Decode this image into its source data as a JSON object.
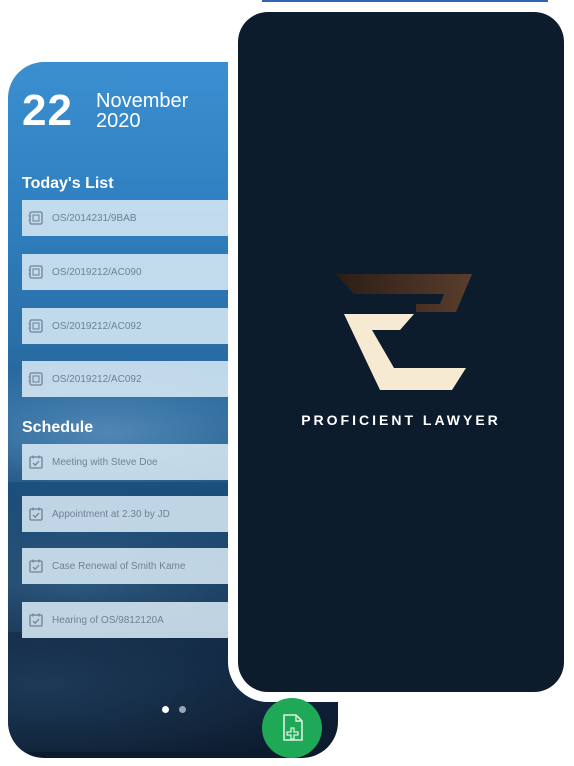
{
  "back_screen": {
    "date": {
      "day": "22",
      "month": "November",
      "year": "2020"
    },
    "todays_list": {
      "title": "Today's List",
      "items": [
        "OS/2014231/9BAB",
        "OS/2019212/AC090",
        "OS/2019212/AC092",
        "OS/2019212/AC092"
      ]
    },
    "schedule": {
      "title": "Schedule",
      "items": [
        "Meeting with Steve Doe",
        "Appointment at 2.30 by JD",
        "Case Renewal of Smith Kame",
        "Hearing of OS/9812120A"
      ]
    },
    "pager": {
      "pages": 2,
      "active": 1
    },
    "fab_icon": "add-document-icon"
  },
  "front_screen": {
    "logo_icon": "proficient-lawyer-logo",
    "brand_name": "PROFICIENT LAWYER"
  },
  "colors": {
    "splash_bg": "#0d1c2c",
    "fab_green": "#1fa856",
    "logo_dark": "#4a3226",
    "logo_light": "#f6ead3"
  }
}
